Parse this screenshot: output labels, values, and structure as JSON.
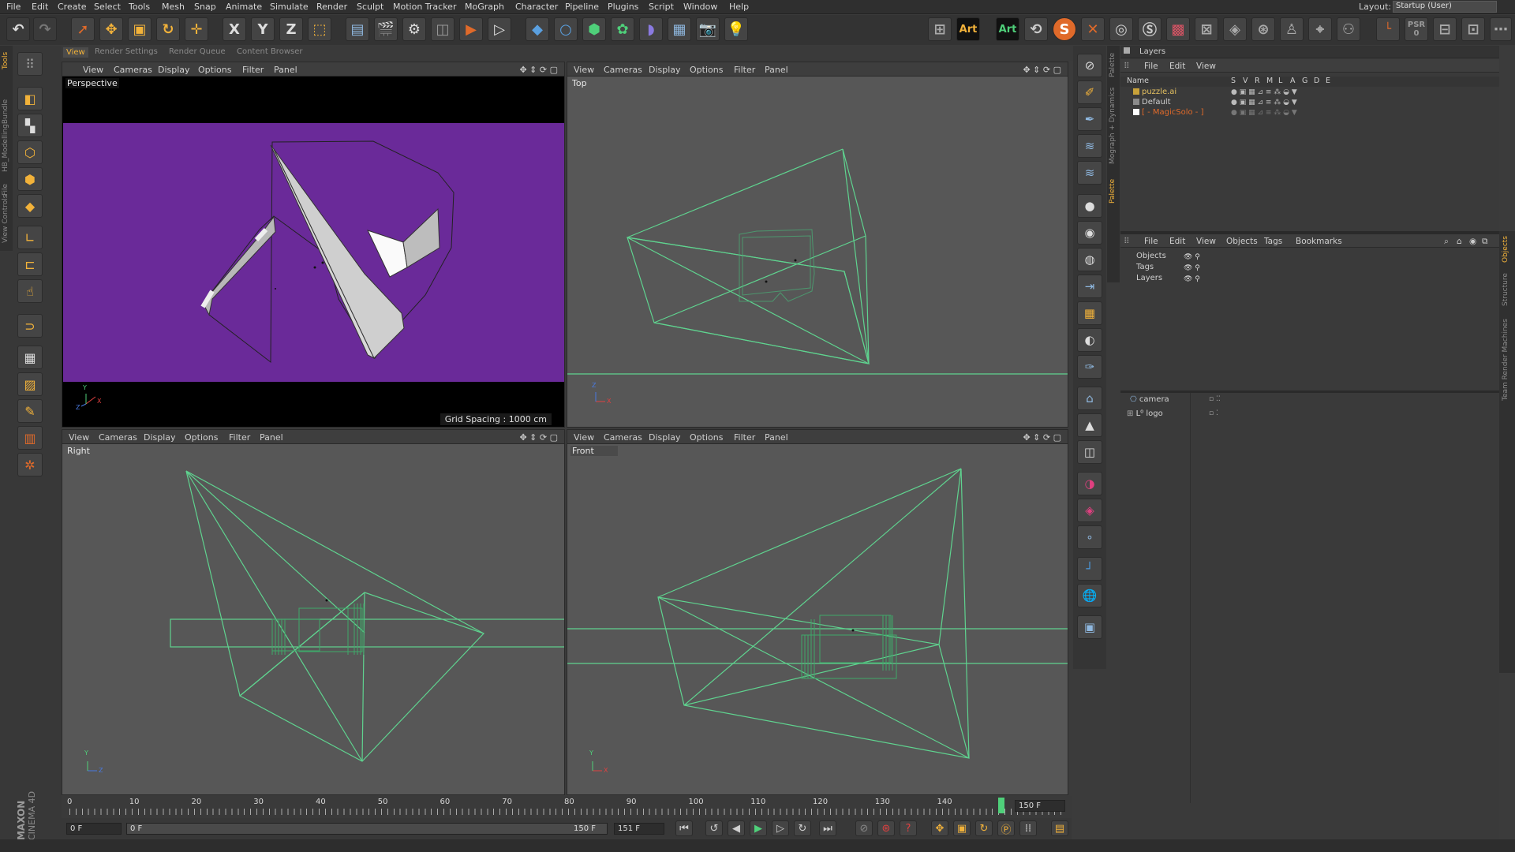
{
  "menu": [
    "File",
    "Edit",
    "Create",
    "Select",
    "Tools",
    "Mesh",
    "Snap",
    "Animate",
    "Simulate",
    "Render",
    "Sculpt",
    "Motion Tracker",
    "MoGraph",
    "Character",
    "Pipeline",
    "Plugins",
    "Script",
    "Window",
    "Help"
  ],
  "layout": {
    "label": "Layout:",
    "value": "Startup (User)"
  },
  "toolbar": {
    "x_label": "X",
    "y_label": "Y",
    "z_label": "Z",
    "art1": "Art",
    "art2": "Art",
    "s_label": "S",
    "psr": "PSR",
    "zero": "0"
  },
  "tabs": [
    "View",
    "Render Settings",
    "Render Queue",
    "Content Browser"
  ],
  "left_vertical_tabs": [
    "Tools",
    "HB_ModellingBundle",
    "File",
    "View Controls"
  ],
  "viewports": {
    "menu": [
      "View",
      "Cameras",
      "Display",
      "Options",
      "Filter",
      "Panel"
    ],
    "perspective": {
      "name": "Perspective",
      "grid_spacing": "Grid Spacing : 1000 cm",
      "bg": "#6a2a99"
    },
    "top": {
      "name": "Top"
    },
    "right": {
      "name": "Right"
    },
    "front": {
      "name": "Front"
    },
    "wire_color": "#5fd38f",
    "axes": {
      "x": "X",
      "y": "Y",
      "z": "Z"
    }
  },
  "right_vertical_tabs": [
    "Palette",
    "Mograph + Dynamics",
    "Palette"
  ],
  "layers_panel": {
    "title": "Layers",
    "menu": [
      "File",
      "Edit",
      "View"
    ],
    "columns": [
      "Name",
      "S",
      "V",
      "R",
      "M",
      "L",
      "A",
      "G",
      "D",
      "E"
    ],
    "rows": [
      {
        "name": "puzzle.ai",
        "color": "#c8a23a"
      },
      {
        "name": "Default",
        "color": "#8a8a8a"
      },
      {
        "name": "[ - MagicSolo - ]",
        "color": "#ffffff"
      }
    ]
  },
  "objects_panel": {
    "menu": [
      "File",
      "Edit",
      "View",
      "Objects",
      "Tags",
      "Bookmarks"
    ],
    "filter_rows": [
      "Objects",
      "Tags",
      "Layers"
    ],
    "objects": [
      "camera",
      "logo"
    ]
  },
  "far_right_tabs": [
    "Objects",
    "Structure",
    "Team Render Machines"
  ],
  "timeline": {
    "ticks": [
      "0",
      "10",
      "20",
      "30",
      "40",
      "50",
      "60",
      "70",
      "80",
      "90",
      "100",
      "110",
      "120",
      "130",
      "140"
    ],
    "end_field": "150 F",
    "current_frame": "0 F",
    "range_start": "0 F",
    "range_end": "150 F",
    "max_frame": "151 F",
    "playhead_frame": 150
  },
  "brand": {
    "line1": "MAXON",
    "line2": "CINEMA 4D"
  }
}
